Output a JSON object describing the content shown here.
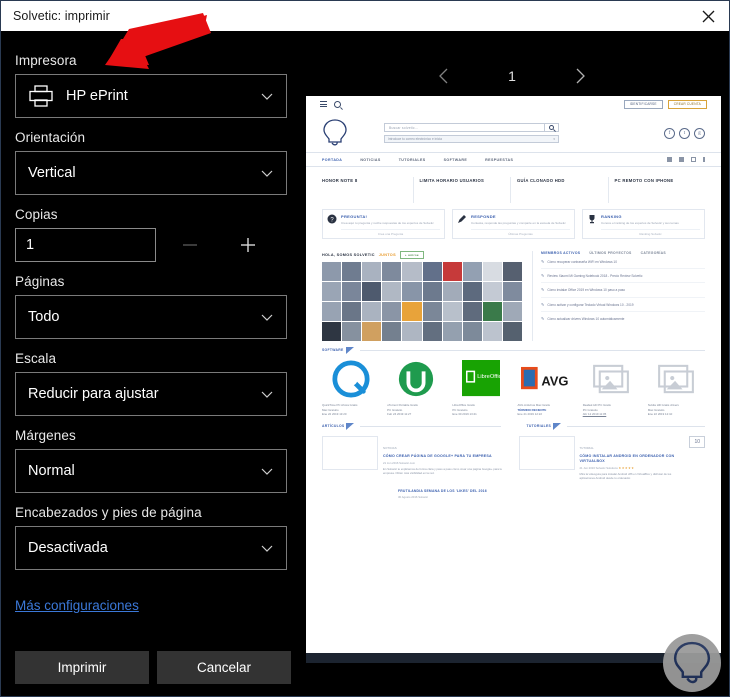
{
  "window": {
    "title": "Solvetic: imprimir",
    "close_label": "×"
  },
  "settings": {
    "printer": {
      "label": "Impresora",
      "value": "HP ePrint",
      "icon": "printer-icon"
    },
    "orientation": {
      "label": "Orientación",
      "value": "Vertical"
    },
    "copies": {
      "label": "Copias",
      "value": "1",
      "minus": "−",
      "plus": "+"
    },
    "pages": {
      "label": "Páginas",
      "value": "Todo"
    },
    "scale": {
      "label": "Escala",
      "value": "Reducir para ajustar"
    },
    "margins": {
      "label": "Márgenes",
      "value": "Normal"
    },
    "headers_footers": {
      "label": "Encabezados y pies de página",
      "value": "Desactivada"
    },
    "more_settings_link": "Más configuraciones"
  },
  "actions": {
    "print": "Imprimir",
    "cancel": "Cancelar"
  },
  "pager": {
    "prev": "‹",
    "next": "›",
    "current_page": "1"
  },
  "preview": {
    "topbar": {
      "btn_identificarse": "IDENTIFICARSE",
      "btn_crear_cuenta": "CREAR CUENTA"
    },
    "search": {
      "placeholder": "Buscar solvetic...",
      "filter": "Introduce tu correo electrónico e inicia"
    },
    "nav": [
      "PORTADA",
      "NOTICIAS",
      "TUTORIALES",
      "SOFTWARE",
      "RESPUESTAS"
    ],
    "categories": [
      "HONOR NOTE 8",
      "LIMITA HORARIO USUARIOS",
      "GUÍA CLONADO HDD",
      "PC REMOTO CON IPHONE"
    ],
    "cards": [
      {
        "icon": "question-icon",
        "title": "PREGUNTA!",
        "desc": "Crea aquí tu pregunta y recibe respuestas de los expertos de Solvetic",
        "footer": "Crea una Pregunta"
      },
      {
        "icon": "pencil-icon",
        "title": "RESPONDE",
        "desc": "Contesta, responde las preguntas y comparte en la escuela de Solvetic",
        "footer": "Últimas Preguntas"
      },
      {
        "icon": "trophy-icon",
        "title": "RANKING",
        "desc": "Conoce el ranking de los expertos de Solvetic y sus temas",
        "footer": "Ranking Solvetic"
      }
    ],
    "community": {
      "title": "HOLA, SOMOS SOLVETIC",
      "title_accent": "JUNTOS",
      "chip": "+ unirse"
    },
    "tabs": [
      "MIEMBROS ACTIVOS",
      "ÚLTIMOS PROYECTOS",
      "CATEGORÍAS"
    ],
    "list_items": [
      "Cómo recuperar contraseña WiFi en Windows 10",
      "Review Xiaomi Mi Gaming Notebook 2018 - Precio Review Solvetic",
      "Cómo instalar Office 2019 en Windows 10 paso a paso",
      "Cómo activar y configurar Teclado Virtual Windows 10 - 2019",
      "Cómo actualizar drivers Windows 10 automáticamente"
    ],
    "software_section": {
      "tag": "SOFTWARE"
    },
    "software": [
      {
        "name": "QuickTime PC Ahora Gratis",
        "meta": "Mac Gratuito",
        "date": "Ene 22 2019 13:20"
      },
      {
        "name": "uTorrent Portable Gratis",
        "meta": "PC Gratuito",
        "date": "Feb 24 2019 11:27"
      },
      {
        "name": "LibreOffice Gratis",
        "meta": "PC Gratuito",
        "date": "Ene 30 2019 13:41"
      },
      {
        "name": "AVG Antivirus Mac Gratis",
        "meta": "TÉRMINO RECIENTE",
        "date": "Ene 21 2019 12:22"
      },
      {
        "name": "Realtek HD PC Gratis",
        "meta": "PC Gratuito",
        "date": "Abr 12 2019 11:05"
      },
      {
        "name": "Nvidia HD Gratis drivers",
        "meta": "Mac Gratuito",
        "date": "Ene 22 2019 12:10"
      }
    ],
    "article_section_left": {
      "tag": "ARTÍCULOS"
    },
    "article_section_right": {
      "tag": "TUTORIALES"
    },
    "articles": [
      {
        "kicker": "NOTICIAS",
        "title": "CÓMO CREAR PÁGINA DE GOOGLE+ PARA TU EMPRESA",
        "sub": "21 Jun 2016   Solvetic.com",
        "body": "En Solvetic te explicamos de forma clara y paso a paso cómo crear una página Google+ para tu empresa. Obtén más visibilidad en la red."
      },
      {
        "kicker": "TUTORIAL",
        "title": "CÓMO INSTALAR ANDROID EN ORDENADOR CON VIRTUALBOX",
        "sub": "21 Jun 2016   Solvetic Solutions",
        "body": "Mira la videoguía para instalar Android x86 en VirtualBox y disfrutar de tus aplicaciones Android desde tu ordenador.",
        "count_badge": "10"
      }
    ],
    "extra_article": {
      "title": "FRUTILANDIA SEMANA DE LOS 'LIKES' DEL 2016",
      "sub": "30 Agosto 2016   Solvetic"
    }
  },
  "colors": {
    "accent_red": "#e60f12",
    "link_blue": "#3b78d8",
    "panel_bg": "#000000",
    "button_bg": "#333333",
    "brand_blue": "#3a5fae"
  }
}
